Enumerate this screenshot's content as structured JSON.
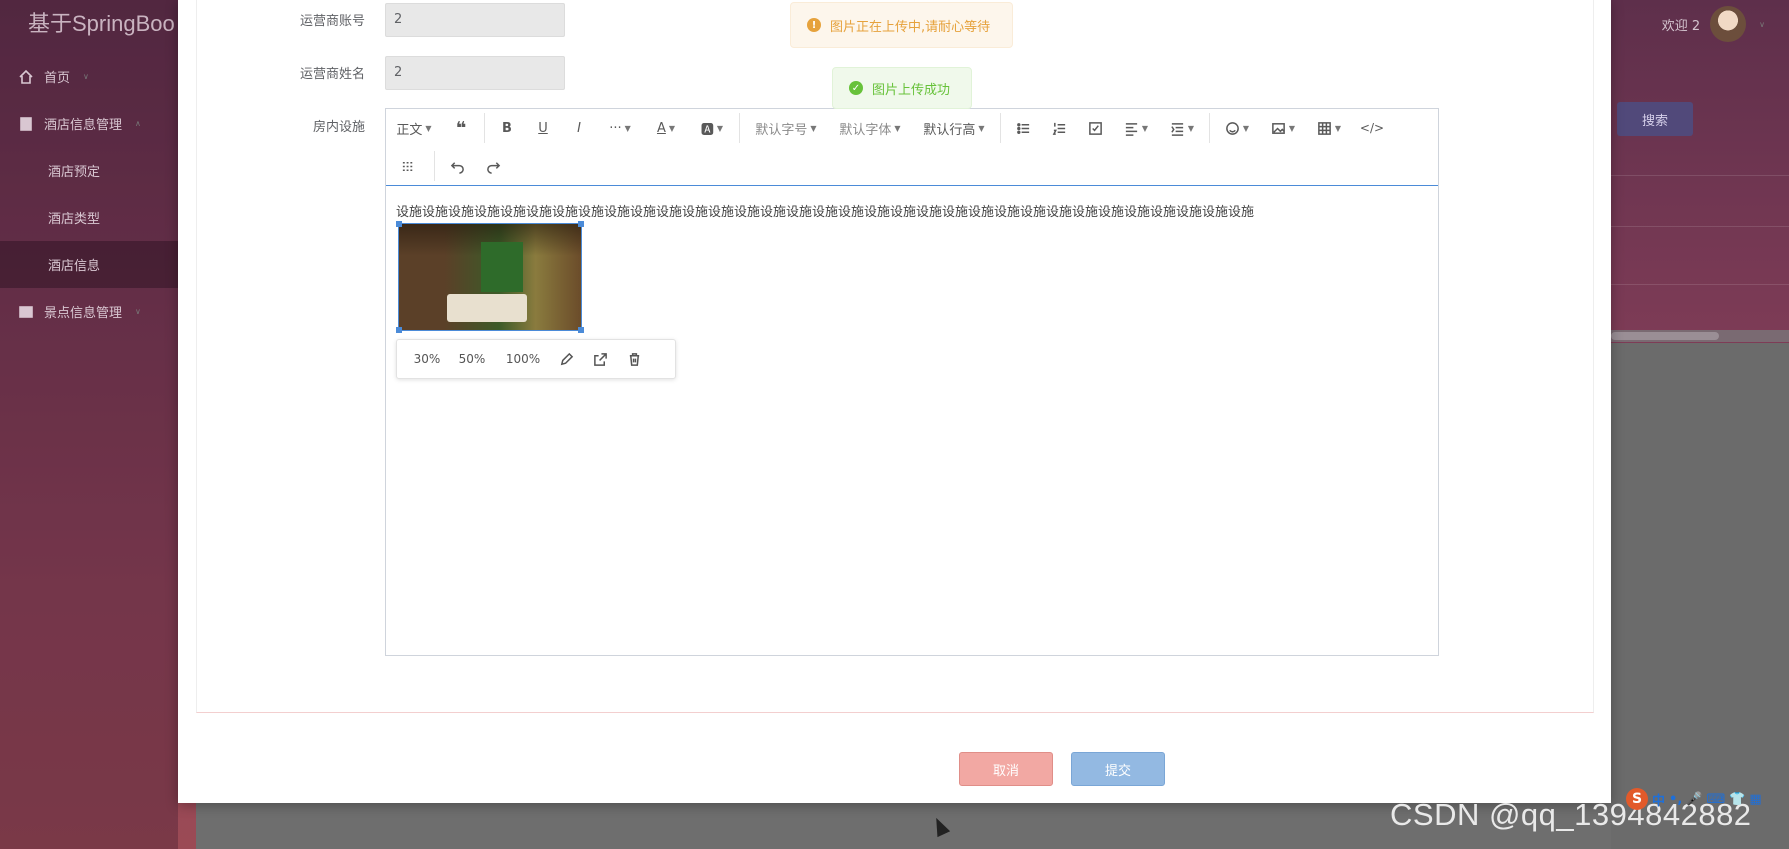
{
  "app": {
    "brand": "基于SpringBoo",
    "welcome": "欢迎 2"
  },
  "sidebar": {
    "items": [
      {
        "label": "首页",
        "icon": "home-icon"
      },
      {
        "label": "酒店信息管理",
        "icon": "book-icon"
      },
      {
        "label": "酒店预定"
      },
      {
        "label": "酒店类型"
      },
      {
        "label": "酒店信息"
      },
      {
        "label": "景点信息管理",
        "icon": "image-icon"
      }
    ]
  },
  "background": {
    "search_label": "搜索"
  },
  "form": {
    "account_label": "运营商账号",
    "account_value": "2",
    "name_label": "运营商姓名",
    "name_value": "2",
    "facility_label": "房内设施"
  },
  "editor": {
    "toolbar": {
      "heading": "正文",
      "font_size": "默认字号",
      "font_family": "默认字体",
      "line_height": "默认行高"
    },
    "content_text": "设施设施设施设施设施设施设施设施设施设施设施设施设施设施设施设施设施设施设施设施设施设施设施设施设施设施设施设施设施设施设施设施设施",
    "image_menu": {
      "p30": "30%",
      "p50": "50%",
      "p100": "100%"
    }
  },
  "toasts": {
    "warning": "图片正在上传中,请耐心等待",
    "success": "图片上传成功"
  },
  "buttons": {
    "cancel": "取消",
    "submit": "提交"
  },
  "watermark": "CSDN @qq_1394842882",
  "ime": {
    "mode": "中"
  },
  "colors": {
    "warning": "#e6a23c",
    "success": "#67c23a",
    "cancel": "#f2a8a3",
    "submit": "#93b9e2",
    "editor_accent": "#4b8bd8"
  }
}
